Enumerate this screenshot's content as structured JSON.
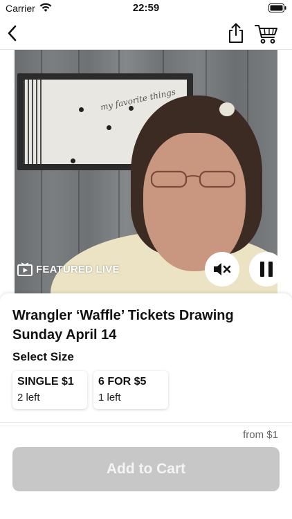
{
  "status_bar": {
    "carrier": "Carrier",
    "time": "22:59"
  },
  "nav": {
    "back_icon": "chevron-left",
    "share_icon": "share",
    "cart_icon": "cart"
  },
  "video": {
    "badge_label": "FEATURED LIVE",
    "wall_sign_text": "my favorite things",
    "mute_icon": "speaker-muted",
    "pause_icon": "pause"
  },
  "product": {
    "title": "Wrangler ‘Waffle’ Tickets Drawing Sunday April 14",
    "size_heading": "Select Size",
    "sizes": [
      {
        "name": "SINGLE $1",
        "stock": "2 left"
      },
      {
        "name": "6 FOR $5",
        "stock": "1 left"
      }
    ]
  },
  "footer": {
    "price_from": "from $1",
    "add_to_cart": "Add to Cart"
  },
  "colors": {
    "button_disabled": "#c7c7c7",
    "text_primary": "#111111",
    "text_secondary": "#666666"
  }
}
